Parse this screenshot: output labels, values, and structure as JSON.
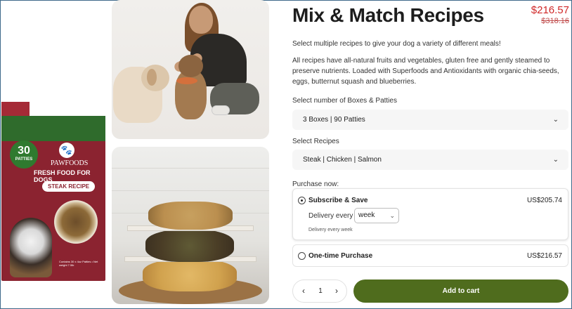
{
  "product": {
    "title": "Mix & Match Recipes",
    "price_current": "$216.57",
    "price_original": "$318.16",
    "description_1": "Select multiple recipes to give your dog a variety of different meals!",
    "description_2": "All recipes have all-natural fruits and vegetables, gluten free and gently steamed to preserve nutrients. Loaded with Superfoods and Antioxidants with organic chia-seeds, eggs, butternut squash and blueberries."
  },
  "box_image": {
    "badge_number": "30",
    "badge_label": "PATTIES",
    "brand": "PAWFOODS",
    "tagline": "FRESH FOOD FOR DOGS",
    "recipe": "STEAK RECIPE",
    "fine_print": "Contains 30 x 4oz Patties • Net weight 7.5lb"
  },
  "boxes_select": {
    "label": "Select number of Boxes & Patties",
    "value": "3 Boxes | 90 Patties"
  },
  "recipes_select": {
    "label": "Select Recipes",
    "value": "Steak | Chicken | Salmon"
  },
  "purchase": {
    "label": "Purchase now:",
    "subscribe": {
      "title": "Subscribe & Save",
      "price": "US$205.74",
      "delivery_label": "Delivery every",
      "delivery_value": "week",
      "delivery_note": "Delivery every week",
      "selected": true
    },
    "one_time": {
      "title": "One-time Purchase",
      "price": "US$216.57",
      "selected": false
    }
  },
  "cart": {
    "quantity": "1",
    "decrement_glyph": "‹",
    "increment_glyph": "›",
    "add_label": "Add to cart"
  },
  "icons": {
    "chevron": "⌄",
    "paw": "🐾"
  },
  "colors": {
    "price_red": "#d02828",
    "cart_green": "#4f6c1d",
    "box_maroon": "#8b2330",
    "box_green": "#2f6b2c"
  }
}
